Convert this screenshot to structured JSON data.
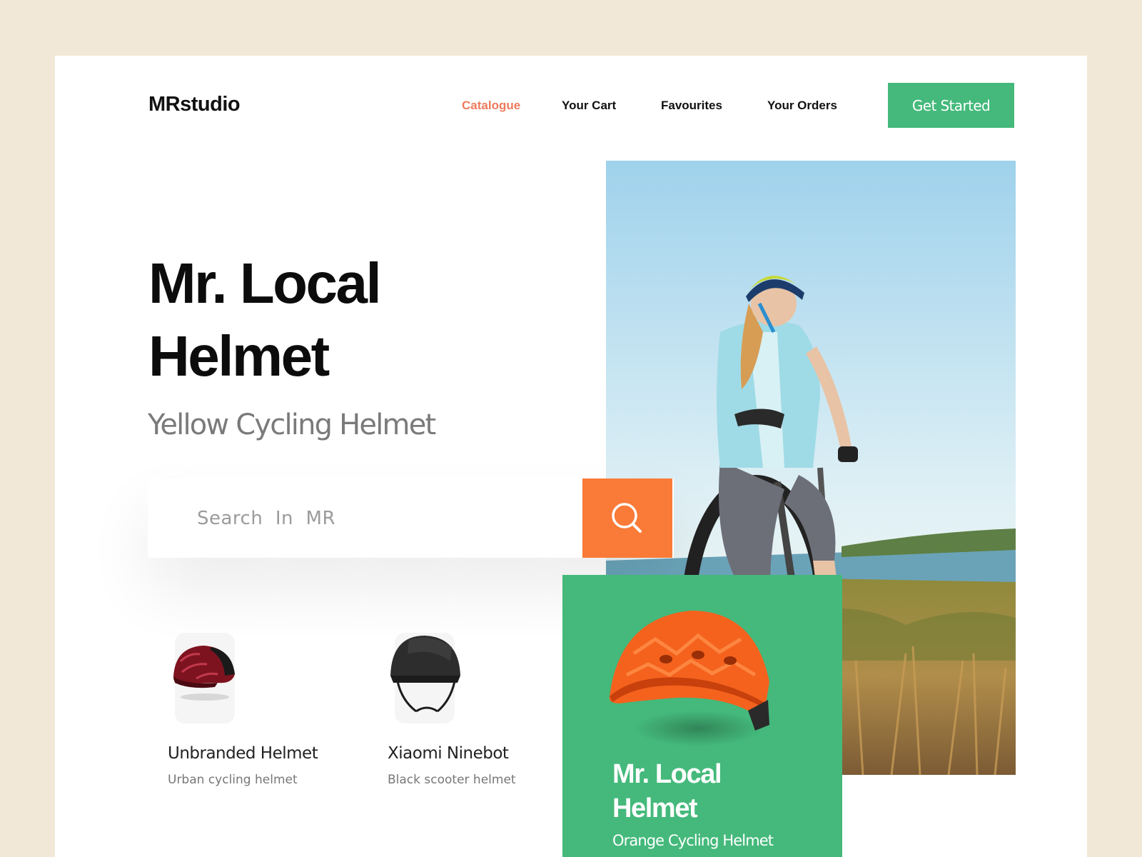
{
  "brand": {
    "logo": "MRstudio"
  },
  "nav": {
    "items": [
      {
        "label": "Catalogue",
        "active": true
      },
      {
        "label": "Your Cart",
        "active": false
      },
      {
        "label": "Favourites",
        "active": false
      },
      {
        "label": "Your Orders",
        "active": false
      }
    ],
    "cta_label": "Get Started"
  },
  "hero": {
    "title_line1": "Mr. Local",
    "title_line2": "Helmet",
    "subtitle": "Yellow Cycling Helmet"
  },
  "search": {
    "placeholder": "Search  In  MR",
    "button_icon": "search-icon"
  },
  "products": [
    {
      "name": "Unbranded Helmet",
      "description": "Urban cycling helmet",
      "icon": "red-helmet-image"
    },
    {
      "name": "Xiaomi Ninebot",
      "description": "Black scooter helmet",
      "icon": "black-helmet-image"
    }
  ],
  "featured": {
    "title_line1": "Mr. Local",
    "title_line2": "Helmet",
    "subtitle": "Orange Cycling Helmet",
    "icon": "orange-helmet-image"
  },
  "colors": {
    "background": "#f2e8d7",
    "accent_green": "#44b97b",
    "accent_orange": "#fa7a37",
    "nav_active": "#ee7a5c"
  }
}
